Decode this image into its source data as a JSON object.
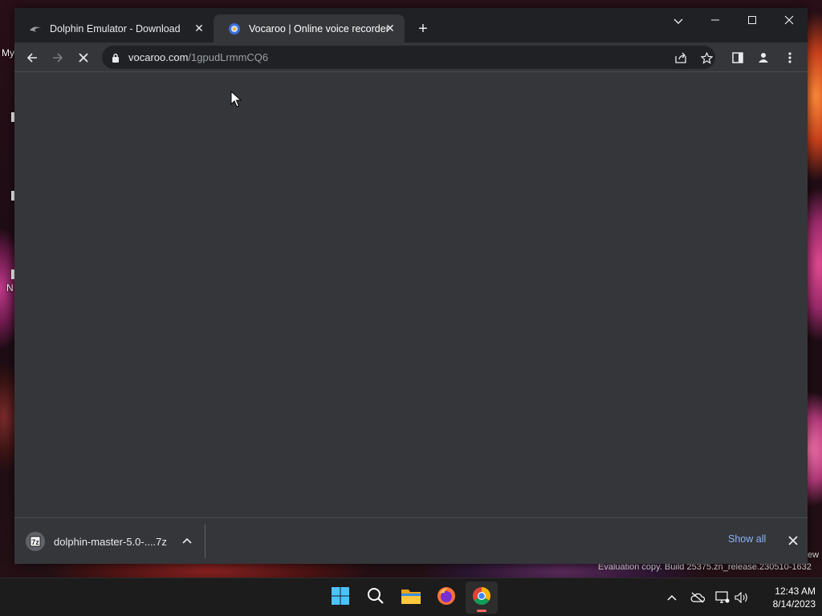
{
  "desktop": {
    "labels": [
      "My",
      "N"
    ],
    "watermark": "Evaluation copy. Build 25375.zn_release.230510-1632",
    "watermark_right": "ew"
  },
  "browser": {
    "tabs": [
      {
        "title": "Dolphin Emulator - Download",
        "active": false,
        "icon": "dolphin-icon"
      },
      {
        "title": "Vocaroo | Online voice recorder",
        "active": true,
        "icon": "vocaroo-icon"
      }
    ],
    "url": {
      "domain": "vocaroo.com",
      "path": "/1gpudLrmmCQ6"
    },
    "status": "loading",
    "theme": {
      "frame": "#202124",
      "surface": "#35363a",
      "link": "#8ab4f8"
    }
  },
  "downloads": {
    "items": [
      {
        "name": "dolphin-master-5.0-....7z",
        "icon": "7zip-icon"
      }
    ],
    "show_all_label": "Show all"
  },
  "taskbar": {
    "apps": [
      {
        "name": "start",
        "icon": "windows-start-icon"
      },
      {
        "name": "search",
        "icon": "search-icon"
      },
      {
        "name": "file-explorer",
        "icon": "folder-icon"
      },
      {
        "name": "firefox",
        "icon": "firefox-icon"
      },
      {
        "name": "chrome",
        "icon": "chrome-icon",
        "running": true
      }
    ],
    "time": "12:43 AM",
    "date": "8/14/2023"
  }
}
